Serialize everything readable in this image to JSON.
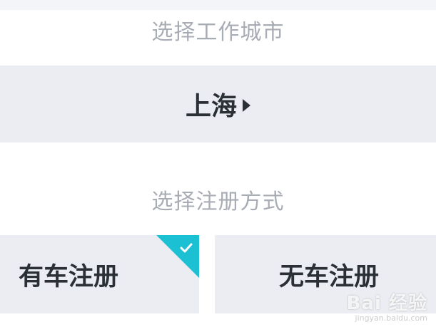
{
  "city_section": {
    "label": "选择工作城市",
    "selected_city": "上海"
  },
  "registration_section": {
    "label": "选择注册方式",
    "options": [
      {
        "label": "有车注册",
        "selected": true
      },
      {
        "label": "无车注册",
        "selected": false
      }
    ]
  },
  "watermark": {
    "brand": "Bai 经验",
    "url": "jingyan.baidu.com"
  },
  "colors": {
    "accent": "#1bc0d3",
    "panel_bg": "#ebedf3",
    "label_gray": "#a8acb4",
    "text_dark": "#2b2f36"
  },
  "icons": {
    "city_caret": "caret-right-icon",
    "selected_mark": "check-icon"
  }
}
